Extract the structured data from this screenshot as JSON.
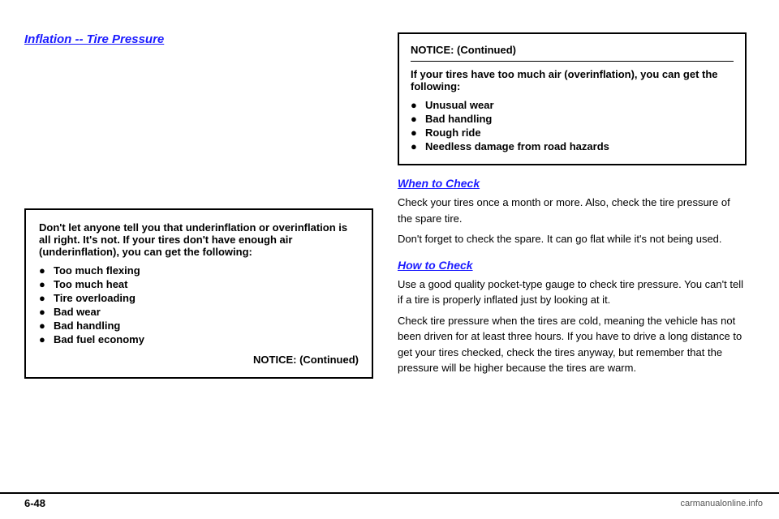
{
  "page": {
    "title": "Inflation -- Tire Pressure",
    "page_number": "6-48",
    "background_color": "#ffffff"
  },
  "right_notice": {
    "title": "NOTICE: (Continued)",
    "intro_text": "If your tires have too much air (overinflation), you can get the following:",
    "items": [
      "Unusual wear",
      "Bad handling",
      "Rough ride",
      "Needless damage from road hazards"
    ]
  },
  "left_notice": {
    "body_text": "Don't let anyone tell you that underinflation or overinflation is all right. It's not. If your tires don't have enough air (underinflation), you can get the following:",
    "items": [
      "Too much flexing",
      "Too much heat",
      "Tire overloading",
      "Bad wear",
      "Bad handling",
      "Bad fuel economy"
    ],
    "continued_label": "NOTICE: (Continued)"
  },
  "when_to_check": {
    "title": "When to Check",
    "text1": "Check your tires once a month or more. Also, check the tire pressure of the spare tire.",
    "text2": "Don't forget to check the spare. It can go flat while it's not being used."
  },
  "how_to_check": {
    "title": "How to Check",
    "text1": "Use a good quality pocket-type gauge to check tire pressure. You can't tell if a tire is properly inflated just by looking at it.",
    "text2": "Check tire pressure when the tires are cold, meaning the vehicle has not been driven for at least three hours. If you have to drive a long distance to get your tires checked, check the tires anyway, but remember that the pressure will be higher because the tires are warm."
  },
  "footer": {
    "logo_text": "carmanualonline.info"
  }
}
